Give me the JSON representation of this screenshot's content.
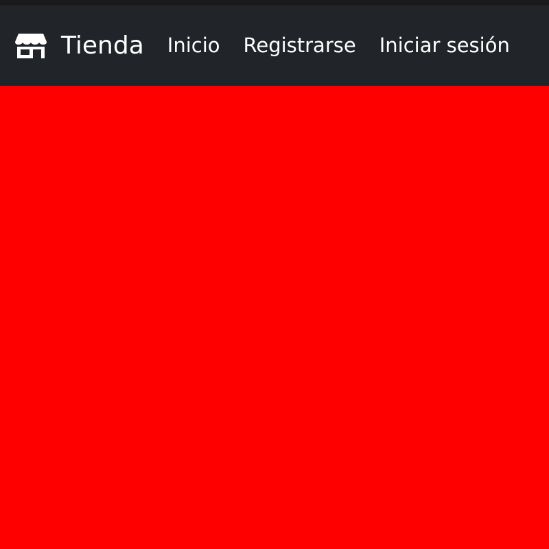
{
  "navbar": {
    "brand": {
      "icon": "store-icon",
      "label": "Tienda"
    },
    "links": [
      {
        "label": "Inicio"
      },
      {
        "label": "Registrarse"
      },
      {
        "label": "Iniciar sesión"
      }
    ]
  },
  "colors": {
    "top_strip": "#1b1a1a",
    "navbar_background": "#212529",
    "navbar_text": "#ffffff",
    "page_background": "#ff0000"
  }
}
